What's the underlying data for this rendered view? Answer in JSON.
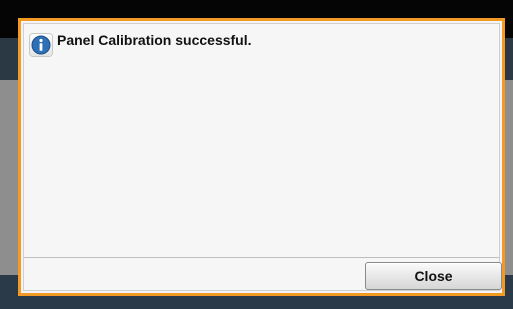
{
  "dialog": {
    "message": "Panel Calibration successful.",
    "icon": "info-icon",
    "close_label": "Close"
  },
  "colors": {
    "dialog_border": "#f29a24",
    "info_icon": "#2f6fb5"
  }
}
